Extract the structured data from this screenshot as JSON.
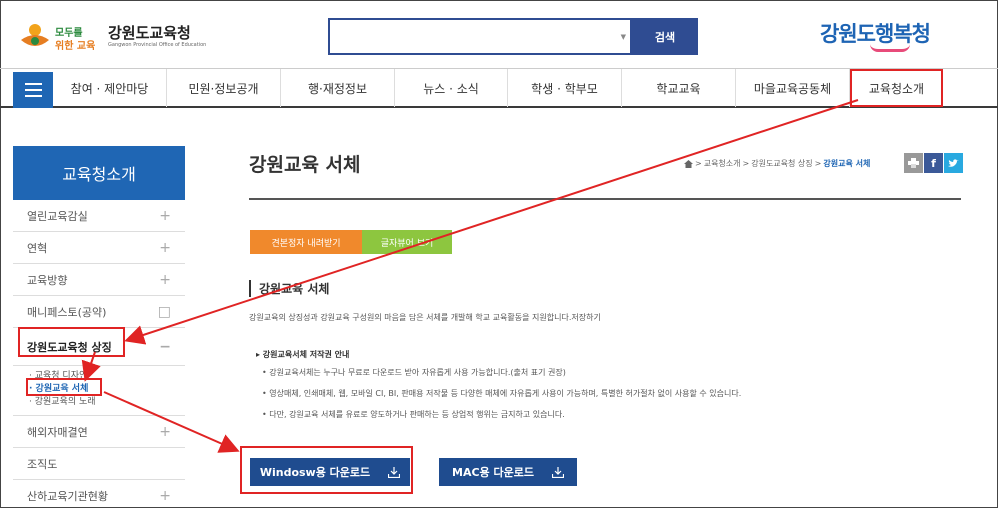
{
  "header": {
    "slogan_line1": "모두를",
    "slogan_line2": "위한 교육",
    "org_name": "강원도교육청",
    "org_name_en": "Gangwon Provincial Office of Education",
    "search_placeholder": "",
    "search_button": "검색",
    "brand_right": "강원도행복청"
  },
  "nav": {
    "menu_icon": "hamburger-icon",
    "items": [
      {
        "label": "참여 · 제안마당"
      },
      {
        "label": "민원·정보공개"
      },
      {
        "label": "행·재정정보"
      },
      {
        "label": "뉴스 · 소식"
      },
      {
        "label": "학생 · 학부모"
      },
      {
        "label": "학교교육"
      },
      {
        "label": "마을교육공동체"
      },
      {
        "label": "교육청소개"
      }
    ]
  },
  "sidebar": {
    "title": "교육청소개",
    "items": [
      {
        "label": "열린교육감실",
        "sign": "+"
      },
      {
        "label": "연혁",
        "sign": "+"
      },
      {
        "label": "교육방향",
        "sign": "+"
      },
      {
        "label": "매니페스토(공약)",
        "sign": "□"
      },
      {
        "label": "강원도교육청 상징",
        "sign": "−"
      }
    ],
    "sub_items": [
      {
        "label": "· 교육청 디자인"
      },
      {
        "label": "· 강원교육 서체"
      },
      {
        "label": "· 강원교육의 노래"
      }
    ],
    "items_after": [
      {
        "label": "해외자매결연",
        "sign": "+"
      },
      {
        "label": "조직도",
        "sign": ""
      },
      {
        "label": "산하교육기관현황",
        "sign": "+"
      }
    ]
  },
  "main": {
    "page_title": "강원교육 서체",
    "breadcrumb": [
      "교육청소개",
      "강원도교육청 상징",
      "강원교육 서체"
    ],
    "tools": {
      "print": "print-icon",
      "facebook": "f",
      "twitter": "twitter-icon"
    },
    "btn_download_sample": "견본정자 내려받기",
    "btn_viewer": "글자뷰어 보기",
    "section_title": "강원교육 서체",
    "section_desc": "강원교육의 상징성과 강원교육 구성원의 마음을 담은 서체를 개발해 학교 교육활동을 지원합니다.저장하기",
    "copyright_title": "▸ 강원교육서체 저작권 안내",
    "copyright_items": [
      "• 강원교육서체는 누구나 무료로 다운로드 받아 자유롭게 사용 가능합니다.(출처 표기 권장)",
      "• 영상매체, 인쇄매체, 웹, 모바일 CI, BI, 판매용 저작물 등 다양한 매체에 자유롭게 사용이 가능하며, 특별한 허가절차 없이 사용할 수 있습니다.",
      "• 다만, 강원교육 서체를 유료로 양도하거나 판매하는 등 상업적 행위는 금지하고 있습니다."
    ],
    "download_windows": "Windosw용 다운로드",
    "download_mac": "MAC용 다운로드"
  },
  "colors": {
    "primary_blue": "#1f66b4",
    "dark_blue": "#1f4c8f",
    "highlight_red": "#e02424",
    "orange": "#f0892c",
    "green": "#8dc63f"
  }
}
